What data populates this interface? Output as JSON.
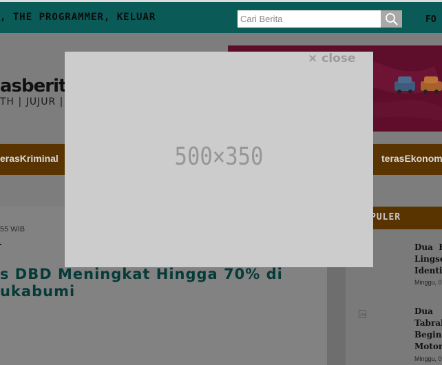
{
  "topbar": {
    "ticker": ", THE PROGRAMMER, KELUAR",
    "search_placeholder": "Cari Berita",
    "right_text": "FO"
  },
  "header": {
    "logo": "asberit",
    "tagline": "TH | JUJUR | J"
  },
  "nav": {
    "items": [
      {
        "label": "erasKriminal"
      },
      {
        "label": "terasEkonomi"
      }
    ]
  },
  "article": {
    "meta": "55 WIB",
    "headline_line1": "s DBD Meningkat Hingga 70% di",
    "headline_line2": "ukabumi"
  },
  "sidebar": {
    "heading": "PULER",
    "items": [
      {
        "title": "Dua  K\nLingse\nIdenti",
        "date": "Minggu, 0"
      },
      {
        "title": "Dua\nTabrak\nBegini\nMotorr",
        "date": "Minggu, 0"
      }
    ]
  },
  "modal": {
    "close_label": "× close",
    "placeholder": "500×350"
  }
}
